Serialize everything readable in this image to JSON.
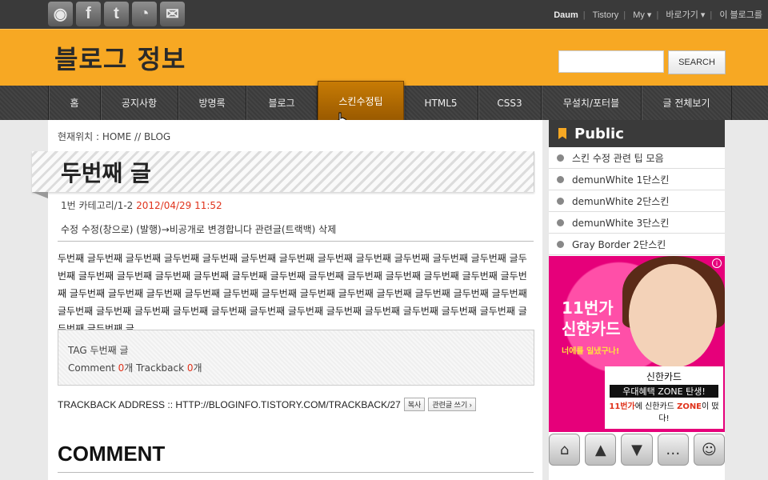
{
  "social": [
    "rss-icon",
    "facebook-icon",
    "twitter-icon",
    "me2day-icon",
    "mail-icon"
  ],
  "toplinks": {
    "daum": "Daum",
    "tistory": "Tistory",
    "my": "My ▾",
    "goto": "바로가기 ▾",
    "thisblog": "이 블로그를"
  },
  "header": {
    "title": "블로그 정보",
    "search_label": "SEARCH"
  },
  "nav": [
    "홈",
    "공지사항",
    "방명록",
    "블로그",
    "스킨수정팁",
    "HTML5",
    "CSS3",
    "무설치/포터블",
    "글 전체보기"
  ],
  "nav_widths": [
    64,
    96,
    84,
    88,
    106,
    92,
    78,
    124,
    112
  ],
  "nav_active": 4,
  "post": {
    "breadcrumb": "현재위치 : HOME // BLOG",
    "title": "두번째 글",
    "category": "1번 카테고리/1-2",
    "date": "2012/04/29 11:52",
    "actions": "수정 수정(창으로) (발행)→비공개로 변경합니다 관련글(트랙백) 삭제",
    "body": "두번째 글두번째 글두번째 글두번째 글두번째 글두번째 글두번째 글두번째 글두번째 글두번째 글두번째 글두번째 글두번째 글두번째 글두번째 글두번째 글두번째 글두번째 글두번째 글두번째 글두번째 글두번째 글두번째 글두번째 글두번째 글두번째 글두번째 글두번째 글두번째 글두번째 글두번째 글두번째 글두번째 글두번째 글두번째 글두번째 글두번째 글두번째 글두번째 글두번째 글두번째 글두번째 글두번째 글두번째 글두번째 글두번째 글두번째 글두번째 글두번째 글두번째 글두번째 글",
    "tag_label": "TAG",
    "tag_value": "두번째 글",
    "comment_label": "Comment",
    "comment_count": "0",
    "comment_unit": "개",
    "trackback_label": "Trackback",
    "trackback_count": "0",
    "trackback_unit": "개",
    "trackback_address": "TRACKBACK ADDRESS :: HTTP://BLOGINFO.TISTORY.COM/TRACKBACK/27",
    "copy_label": "복사",
    "write_related_label": "관련글 쓰기 ›",
    "comment_heading": "COMMENT"
  },
  "sidebar": {
    "title": "Public",
    "items": [
      "스킨 수정 관련 팁 모음",
      "demunWhite 1단스킨",
      "demunWhite 2단스킨",
      "demunWhite 3단스킨",
      "Gray Border 2단스킨"
    ],
    "ad": {
      "text1": "11번가 신한카드",
      "text2": "너에를 일냈구나!",
      "line1": "신한카드",
      "line2": "우대혜택 ZONE 탄생!",
      "line3a": "11번가",
      "line3b": "에 신한카드 ",
      "line3c": "ZONE",
      "line3d": "이 떴다!"
    }
  },
  "bottom_icons": [
    "home-icon",
    "up-arrow-icon",
    "down-arrow-icon",
    "chat-icon",
    "user-icon"
  ]
}
